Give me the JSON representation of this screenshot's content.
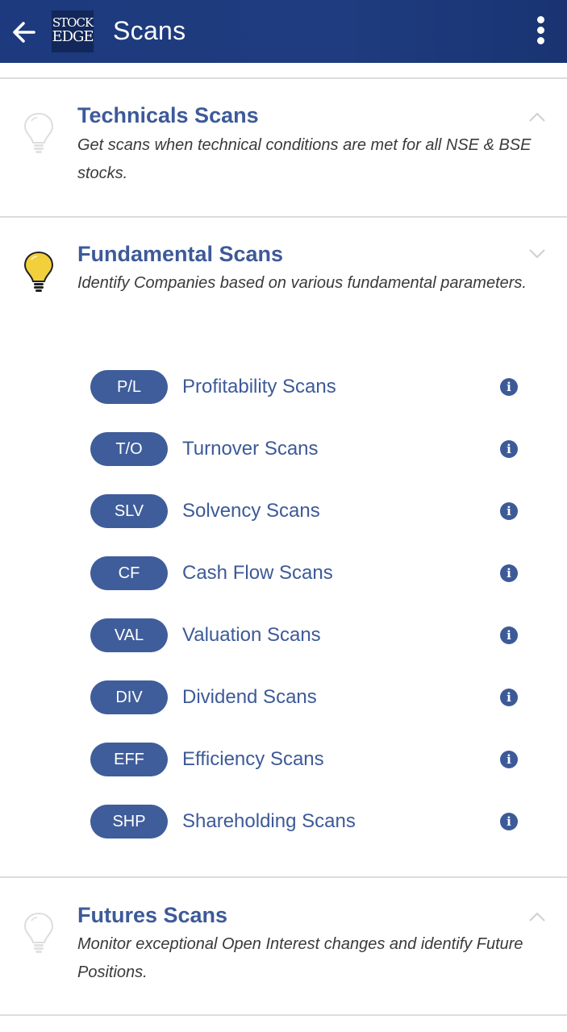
{
  "appbar": {
    "title": "Scans",
    "logo_line1": "STOCK",
    "logo_line2": "EDGE",
    "back_icon": "arrow-left-icon",
    "menu_icon": "more-vertical-icon"
  },
  "sections": [
    {
      "title": "Technicals Scans",
      "description": "Get scans when technical conditions are met for all NSE & BSE stocks.",
      "expanded": false,
      "icon": "lightbulb-outline-icon"
    },
    {
      "title": "Fundamental Scans",
      "description": "Identify Companies based on various fundamental parameters.",
      "expanded": true,
      "icon": "lightbulb-yellow-icon",
      "scans": [
        {
          "code": "P/L",
          "label": "Profitability Scans"
        },
        {
          "code": "T/O",
          "label": "Turnover Scans"
        },
        {
          "code": "SLV",
          "label": "Solvency Scans"
        },
        {
          "code": "CF",
          "label": "Cash Flow Scans"
        },
        {
          "code": "VAL",
          "label": "Valuation Scans"
        },
        {
          "code": "DIV",
          "label": "Dividend Scans"
        },
        {
          "code": "EFF",
          "label": "Efficiency Scans"
        },
        {
          "code": "SHP",
          "label": "Shareholding Scans"
        }
      ]
    },
    {
      "title": "Futures Scans",
      "description": "Monitor exceptional Open Interest changes and identify Future Positions.",
      "expanded": false,
      "icon": "lightbulb-outline-icon"
    }
  ],
  "colors": {
    "appbar": "#1e3c7f",
    "accent": "#3d5a98",
    "pill": "#3f5d9a",
    "bulb_active": "#f2d03b"
  }
}
